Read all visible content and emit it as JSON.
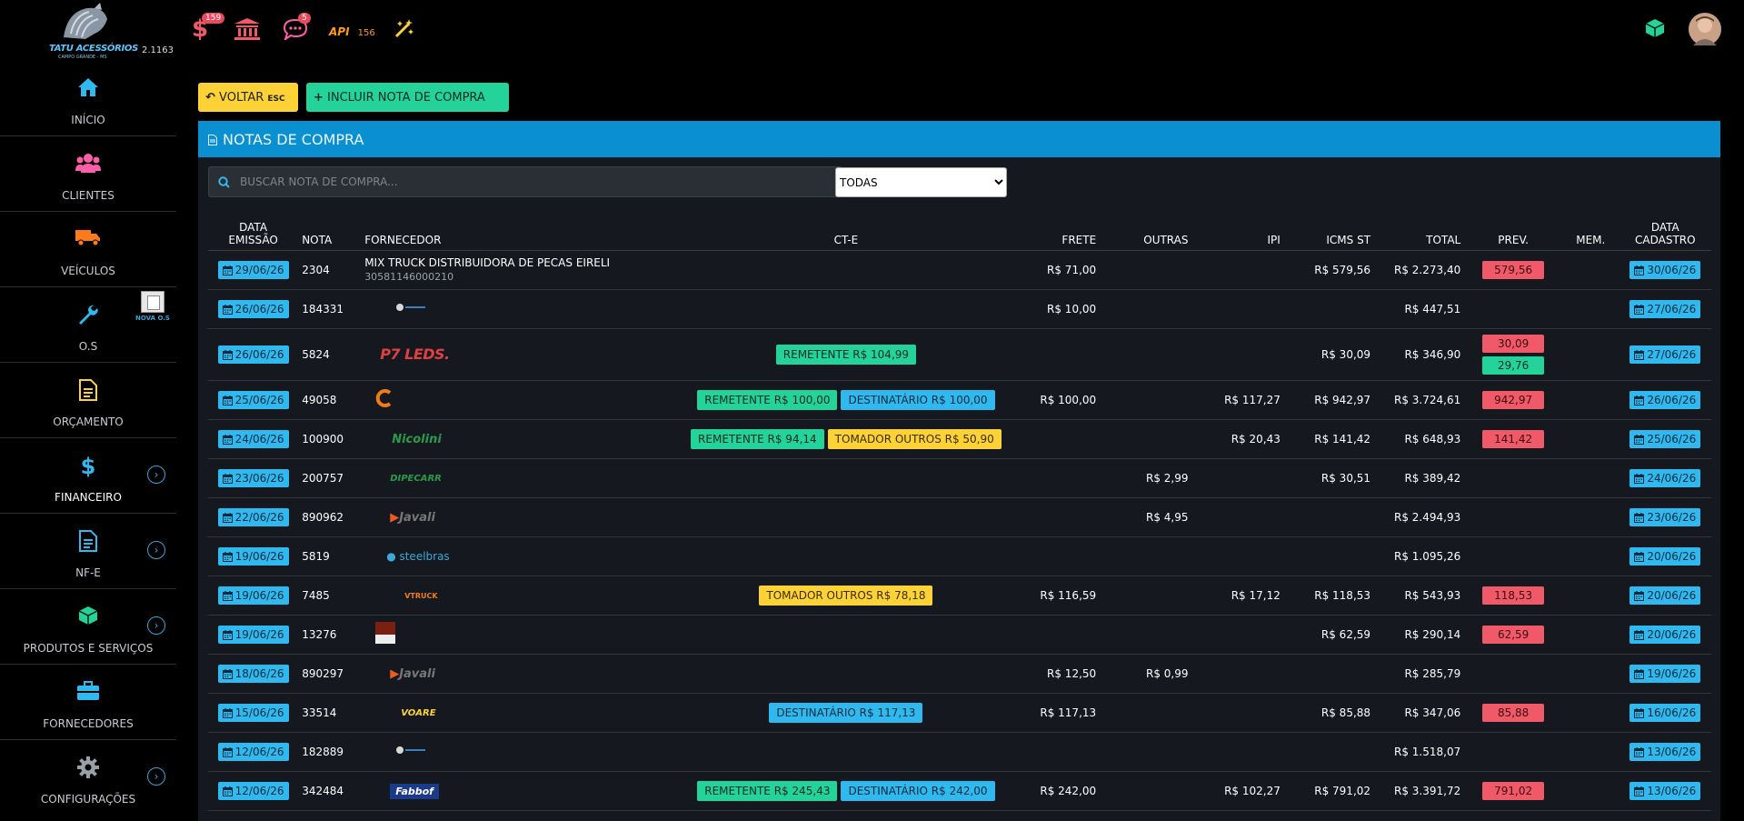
{
  "app": {
    "logo_text": "TATU ACESSÓRIOS",
    "logo_sub": "CAMPO GRANDE - MS",
    "version": "2.1163"
  },
  "topbar": {
    "finance_badge": "159",
    "messages_badge": "5",
    "api_label": "API",
    "api_count": "156"
  },
  "sidebar": {
    "items": [
      {
        "label": "INÍCIO",
        "icon": "home-icon"
      },
      {
        "label": "CLIENTES",
        "icon": "users-icon"
      },
      {
        "label": "VEÍCULOS",
        "icon": "truck-icon"
      },
      {
        "label": "O.S",
        "icon": "wrench-icon"
      },
      {
        "label": "ORÇAMENTO",
        "icon": "document-icon"
      },
      {
        "label": "FINANCEIRO",
        "icon": "dollar-icon",
        "expandable": true
      },
      {
        "label": "NF-E",
        "icon": "file-icon",
        "expandable": true
      },
      {
        "label": "PRODUTOS E SERVIÇOS",
        "icon": "cube-icon",
        "expandable": true
      },
      {
        "label": "FORNECEDORES",
        "icon": "briefcase-icon"
      },
      {
        "label": "CONFIGURAÇÕES",
        "icon": "gear-icon",
        "expandable": true
      }
    ],
    "nova_os_label": "NOVA O.S"
  },
  "toolbar": {
    "back_label": "VOLTAR",
    "back_shortcut": "ESC",
    "add_label": "INCLUIR NOTA DE COMPRA"
  },
  "panel": {
    "title": "NOTAS DE COMPRA",
    "search_placeholder": "BUSCAR NOTA DE COMPRA...",
    "filter_selected": "TODAS"
  },
  "table": {
    "headers": {
      "data_emissao_1": "DATA",
      "data_emissao_2": "EMISSÃO",
      "nota": "NOTA",
      "fornecedor": "FORNECEDOR",
      "cte": "CT-E",
      "frete": "FRETE",
      "outras": "OUTRAS",
      "ipi": "IPI",
      "icms_st": "ICMS ST",
      "total": "TOTAL",
      "prev": "PREV.",
      "mem": "MEM.",
      "data_cadastro_1": "DATA",
      "data_cadastro_2": "CADASTRO"
    },
    "rows": [
      {
        "emissao": "29/06/26",
        "nota": "2304",
        "fornecedor": "MIX TRUCK DISTRIBUIDORA DE PECAS EIRELI",
        "cnpj": "30581146000210",
        "logo": "",
        "cte": [],
        "frete": "R$ 71,00",
        "outras": "",
        "ipi": "",
        "icms_st": "R$ 579,56",
        "total": "R$ 2.273,40",
        "prev": "579,56",
        "prev2": "",
        "cadastro": "30/06/26"
      },
      {
        "emissao": "26/06/26",
        "nota": "184331",
        "fornecedor": "",
        "cnpj": "",
        "logo": "small-logo",
        "cte": [],
        "frete": "R$ 10,00",
        "outras": "",
        "ipi": "",
        "icms_st": "",
        "total": "R$ 447,51",
        "prev": "",
        "prev2": "",
        "cadastro": "27/06/26"
      },
      {
        "emissao": "26/06/26",
        "nota": "5824",
        "fornecedor": "",
        "cnpj": "",
        "logo": "P7 LEDS.",
        "cte": [
          {
            "type": "rem",
            "label": "REMETENTE R$ 104,99"
          }
        ],
        "frete": "",
        "outras": "",
        "ipi": "",
        "icms_st": "R$ 30,09",
        "total": "R$ 346,90",
        "prev": "30,09",
        "prev2": "29,76",
        "cadastro": "27/06/26"
      },
      {
        "emissao": "25/06/26",
        "nota": "49058",
        "fornecedor": "",
        "cnpj": "",
        "logo": "c-logo",
        "cte": [
          {
            "type": "rem",
            "label": "REMETENTE R$ 100,00"
          },
          {
            "type": "dest",
            "label": "DESTINATÁRIO R$ 100,00"
          }
        ],
        "frete": "R$ 100,00",
        "outras": "",
        "ipi": "R$ 117,27",
        "icms_st": "R$ 942,97",
        "total": "R$ 3.724,61",
        "prev": "942,97",
        "prev2": "",
        "cadastro": "26/06/26"
      },
      {
        "emissao": "24/06/26",
        "nota": "100900",
        "fornecedor": "",
        "cnpj": "",
        "logo": "Nicolini",
        "cte": [
          {
            "type": "rem",
            "label": "REMETENTE R$ 94,14"
          },
          {
            "type": "tom",
            "label": "TOMADOR OUTROS R$ 50,90"
          }
        ],
        "frete": "",
        "outras": "",
        "ipi": "R$ 20,43",
        "icms_st": "R$ 141,42",
        "total": "R$ 648,93",
        "prev": "141,42",
        "prev2": "",
        "cadastro": "25/06/26"
      },
      {
        "emissao": "23/06/26",
        "nota": "200757",
        "fornecedor": "",
        "cnpj": "",
        "logo": "DIPECARR",
        "cte": [],
        "frete": "",
        "outras": "R$ 2,99",
        "ipi": "",
        "icms_st": "R$ 30,51",
        "total": "R$ 389,42",
        "prev": "",
        "prev2": "",
        "cadastro": "24/06/26"
      },
      {
        "emissao": "22/06/26",
        "nota": "890962",
        "fornecedor": "",
        "cnpj": "",
        "logo": "Javali",
        "cte": [],
        "frete": "",
        "outras": "R$ 4,95",
        "ipi": "",
        "icms_st": "",
        "total": "R$ 2.494,93",
        "prev": "",
        "prev2": "",
        "cadastro": "23/06/26"
      },
      {
        "emissao": "19/06/26",
        "nota": "5819",
        "fornecedor": "",
        "cnpj": "",
        "logo": "steelbras",
        "cte": [],
        "frete": "",
        "outras": "",
        "ipi": "",
        "icms_st": "",
        "total": "R$ 1.095,26",
        "prev": "",
        "prev2": "",
        "cadastro": "20/06/26"
      },
      {
        "emissao": "19/06/26",
        "nota": "7485",
        "fornecedor": "",
        "cnpj": "",
        "logo": "VTRUCK",
        "cte": [
          {
            "type": "tom",
            "label": "TOMADOR OUTROS R$ 78,18"
          }
        ],
        "frete": "R$ 116,59",
        "outras": "",
        "ipi": "R$ 17,12",
        "icms_st": "R$ 118,53",
        "total": "R$ 543,93",
        "prev": "118,53",
        "prev2": "",
        "cadastro": "20/06/26"
      },
      {
        "emissao": "19/06/26",
        "nota": "13276",
        "fornecedor": "",
        "cnpj": "",
        "logo": "vtruck-small",
        "cte": [],
        "frete": "",
        "outras": "",
        "ipi": "",
        "icms_st": "R$ 62,59",
        "total": "R$ 290,14",
        "prev": "62,59",
        "prev2": "",
        "cadastro": "20/06/26"
      },
      {
        "emissao": "18/06/26",
        "nota": "890297",
        "fornecedor": "",
        "cnpj": "",
        "logo": "Javali",
        "cte": [],
        "frete": "R$ 12,50",
        "outras": "R$ 0,99",
        "ipi": "",
        "icms_st": "",
        "total": "R$ 285,79",
        "prev": "",
        "prev2": "",
        "cadastro": "19/06/26"
      },
      {
        "emissao": "15/06/26",
        "nota": "33514",
        "fornecedor": "",
        "cnpj": "",
        "logo": "VOARE",
        "cte": [
          {
            "type": "dest",
            "label": "DESTINATÁRIO R$ 117,13"
          }
        ],
        "frete": "R$ 117,13",
        "outras": "",
        "ipi": "",
        "icms_st": "R$ 85,88",
        "total": "R$ 347,06",
        "prev": "85,88",
        "prev2": "",
        "cadastro": "16/06/26"
      },
      {
        "emissao": "12/06/26",
        "nota": "182889",
        "fornecedor": "",
        "cnpj": "",
        "logo": "small-logo",
        "cte": [],
        "frete": "",
        "outras": "",
        "ipi": "",
        "icms_st": "",
        "total": "R$ 1.518,07",
        "prev": "",
        "prev2": "",
        "cadastro": "13/06/26"
      },
      {
        "emissao": "12/06/26",
        "nota": "342484",
        "fornecedor": "",
        "cnpj": "",
        "logo": "Fabbof",
        "cte": [
          {
            "type": "rem",
            "label": "REMETENTE R$ 245,43"
          },
          {
            "type": "dest",
            "label": "DESTINATÁRIO R$ 242,00"
          }
        ],
        "frete": "R$ 242,00",
        "outras": "",
        "ipi": "R$ 102,27",
        "icms_st": "R$ 791,02",
        "total": "R$ 3.391,72",
        "prev": "791,02",
        "prev2": "",
        "cadastro": "13/06/26"
      }
    ]
  }
}
